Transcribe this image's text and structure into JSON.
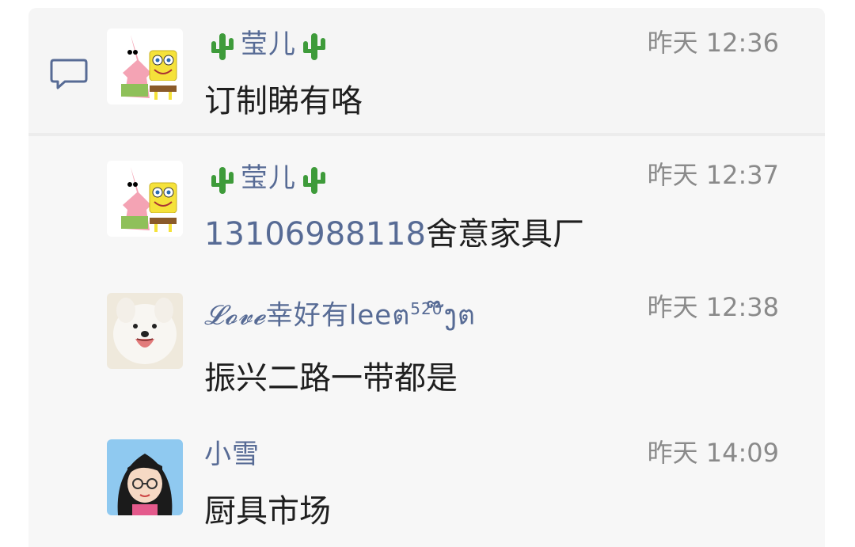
{
  "comments": [
    {
      "name": "莹儿",
      "name_decor": "cactus",
      "time": "昨天 12:36",
      "message": "订制睇有咯",
      "avatar": "patrick-spongebob"
    },
    {
      "name": "莹儿",
      "name_decor": "cactus",
      "time": "昨天 12:37",
      "phone": "13106988118",
      "message": "舍意家具厂",
      "avatar": "patrick-spongebob"
    },
    {
      "name_prefix": "𝓛𝓸𝓿𝓮",
      "name": "幸好有lee",
      "name_suffix": "ต",
      "name_super": "520",
      "name_tail": "໊ງต",
      "time": "昨天 12:38",
      "message": "振兴二路一带都是",
      "avatar": "white-dog"
    },
    {
      "name": "小雪",
      "time": "昨天 14:09",
      "message": "厨具市场",
      "avatar": "girl-cartoon"
    }
  ],
  "colors": {
    "name": "#576b95",
    "time": "#8a8a8a",
    "message": "#1f1f1f",
    "panel": "#f7f7f7"
  }
}
